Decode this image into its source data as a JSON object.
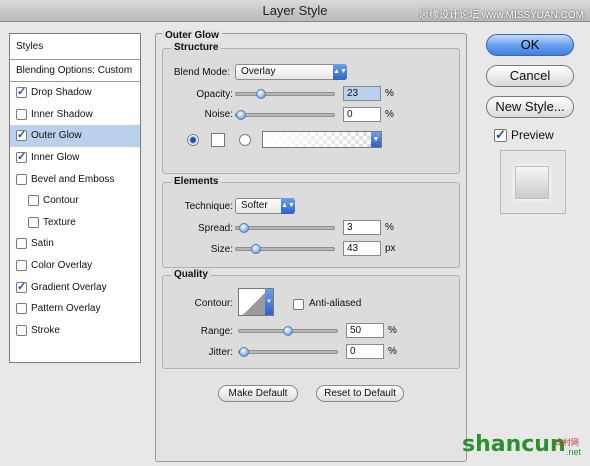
{
  "window": {
    "title": "Layer Style",
    "watermark": "思缘设计论坛 www.MISSYUAN.COM"
  },
  "left_panel": {
    "styles_label": "Styles",
    "blending_label": "Blending Options: Custom",
    "items": [
      {
        "label": "Drop Shadow",
        "checked": true
      },
      {
        "label": "Inner Shadow",
        "checked": false
      },
      {
        "label": "Outer Glow",
        "checked": true,
        "selected": true
      },
      {
        "label": "Inner Glow",
        "checked": true
      },
      {
        "label": "Bevel and Emboss",
        "checked": false
      },
      {
        "label": "Contour",
        "checked": false,
        "indent": true
      },
      {
        "label": "Texture",
        "checked": false,
        "indent": true
      },
      {
        "label": "Satin",
        "checked": false
      },
      {
        "label": "Color Overlay",
        "checked": false
      },
      {
        "label": "Gradient Overlay",
        "checked": true
      },
      {
        "label": "Pattern Overlay",
        "checked": false
      },
      {
        "label": "Stroke",
        "checked": false
      }
    ]
  },
  "main": {
    "title": "Outer Glow",
    "structure": {
      "title": "Structure",
      "blend_mode_label": "Blend Mode:",
      "blend_mode_value": "Overlay",
      "opacity_label": "Opacity:",
      "opacity_value": "23",
      "opacity_unit": "%",
      "opacity_level": 0.23,
      "noise_label": "Noise:",
      "noise_value": "0",
      "noise_unit": "%",
      "noise_level": 0.0
    },
    "elements": {
      "title": "Elements",
      "technique_label": "Technique:",
      "technique_value": "Softer",
      "spread_label": "Spread:",
      "spread_value": "3",
      "spread_unit": "%",
      "spread_level": 0.03,
      "size_label": "Size:",
      "size_value": "43",
      "size_unit": "px",
      "size_level": 0.17
    },
    "quality": {
      "title": "Quality",
      "contour_label": "Contour:",
      "anti_aliased_label": "Anti-aliased",
      "range_label": "Range:",
      "range_value": "50",
      "range_unit": "%",
      "range_level": 0.5,
      "jitter_label": "Jitter:",
      "jitter_value": "0",
      "jitter_unit": "%",
      "jitter_level": 0.0
    },
    "make_default_label": "Make Default",
    "reset_default_label": "Reset to Default"
  },
  "right_panel": {
    "ok_label": "OK",
    "cancel_label": "Cancel",
    "new_style_label": "New Style...",
    "preview_label": "Preview",
    "preview_checked": true
  },
  "brand": {
    "name": "shancun",
    "sub": ".net",
    "cn": "山村网"
  }
}
